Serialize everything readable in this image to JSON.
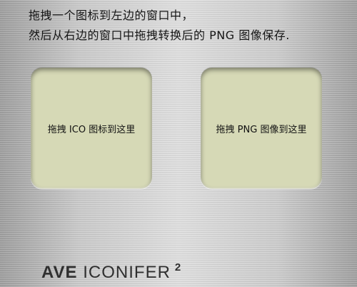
{
  "instructions": {
    "line1": "拖拽一个图标到左边的窗口中，",
    "line2": "然后从右边的窗口中拖拽转换后的 PNG 图像保存."
  },
  "drop_zones": {
    "icon_label": "拖拽 ICO 图标到这里",
    "png_label": "拖拽 PNG 图像到这里"
  },
  "logo": {
    "brand": "AVE",
    "product": "ICONIFER",
    "version": "2"
  },
  "colors": {
    "drop_zone_fill": "#d6d9b6",
    "background": "#c4c4c4",
    "logo_text": "#2f2f2f"
  }
}
